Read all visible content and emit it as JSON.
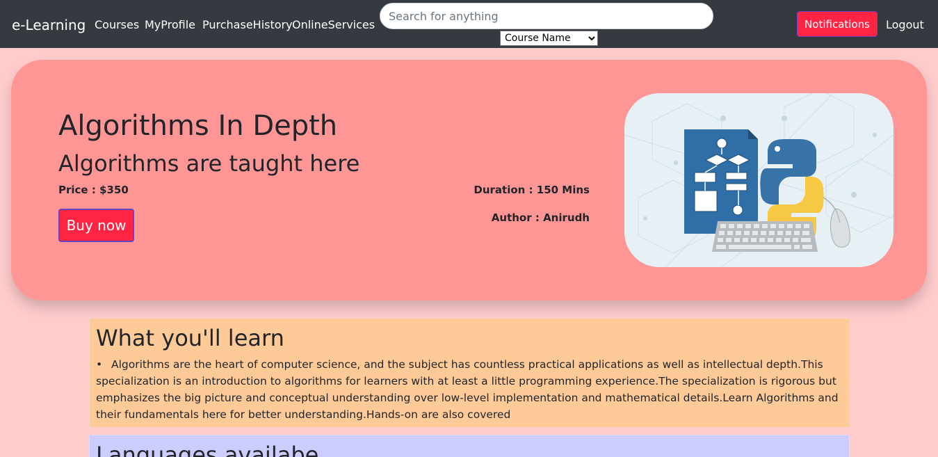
{
  "navbar": {
    "brand": "e-Learning",
    "links": [
      "Courses",
      "MyProfile",
      "PurchaseHistory",
      "OnlineServices"
    ],
    "search_placeholder": "Search for anything",
    "search_filter_selected": "Course Name",
    "notifications_label": "Notifications",
    "logout_label": "Logout"
  },
  "course": {
    "title": "Algorithms In Depth",
    "subtitle": "Algorithms are taught here",
    "price": "Price : $350",
    "duration": "Duration : 150 Mins",
    "author": "Author : Anirudh",
    "buy_label": "Buy now",
    "image_icon": "flowchart-python-keyboard-illustration"
  },
  "learn": {
    "heading": "What you'll learn",
    "items": [
      "Algorithms are the heart of computer science, and the subject has countless practical applications as well as intellectual depth.This specialization is an introduction to algorithms for learners with at least a little programming experience.The specialization is rigorous but emphasizes the big picture and conceptual understanding over low-level implementation and mathematical details.Learn Algorithms and their fundamentals here for better understanding.Hands-on are also covered"
    ]
  },
  "languages": {
    "heading": "Languages availabe"
  },
  "colors": {
    "page_bg": "#ffcccc",
    "navbar_bg": "#343a40",
    "hero_bg": "#ff9696",
    "accent_button": "#ff2442",
    "learn_bg": "#fdca98",
    "languages_bg": "#ccccff"
  }
}
